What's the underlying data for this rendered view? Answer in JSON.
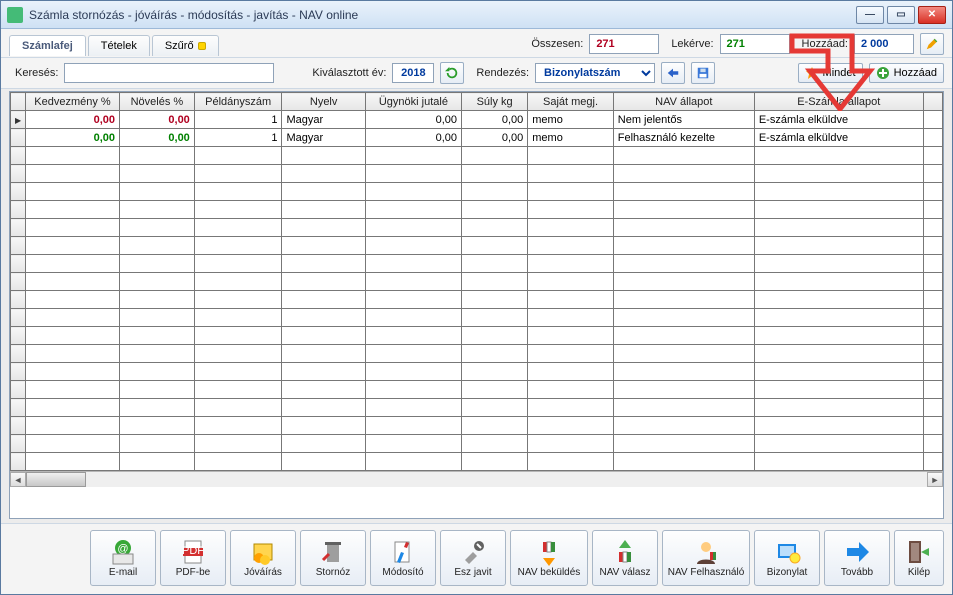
{
  "window": {
    "title": "Számla stornózás - jóváírás - módosítás - javítás - NAV online"
  },
  "tabs": {
    "t0": "Számlafej",
    "t1": "Tételek",
    "t2": "Szűrő"
  },
  "summary": {
    "osszesen_label": "Összesen:",
    "osszesen": "271",
    "lekerve_label": "Lekérve:",
    "lekerve": "271",
    "hozzaad_label": "Hozzáad:",
    "hozzaad": "2 000"
  },
  "toolbar": {
    "kereses_label": "Keresés:",
    "kivalasztott_ev_label": "Kiválasztott év:",
    "year": "2018",
    "rendezes_label": "Rendezés:",
    "rendezes_value": "Bizonylatszám",
    "mindet": "Mindet",
    "hozzaad": "Hozzáad"
  },
  "grid": {
    "headers": {
      "h0": "Kedvezmény %",
      "h1": "Növelés %",
      "h2": "Példányszám",
      "h3": "Nyelv",
      "h4": "Ügynöki jutalé",
      "h5": "Súly kg",
      "h6": "Saját megj.",
      "h7": "NAV állapot",
      "h8": "E-Számla állapot"
    },
    "rows": [
      {
        "kedv": "0,00",
        "nov": "0,00",
        "peld": "1",
        "nyelv": "Magyar",
        "jutalek": "0,00",
        "suly": "0,00",
        "megj": "memo",
        "nav": "Nem jelentős",
        "eszamla": "E-számla elküldve"
      },
      {
        "kedv": "0,00",
        "nov": "0,00",
        "peld": "1",
        "nyelv": "Magyar",
        "jutalek": "0,00",
        "suly": "0,00",
        "megj": "memo",
        "nav": "Felhasználó kezelte",
        "eszamla": "E-számla elküldve"
      }
    ]
  },
  "buttons": {
    "b0": "E-mail",
    "b1": "PDF-be",
    "b2": "Jóváírás",
    "b3": "Stornóz",
    "b4": "Módosító",
    "b5": "Esz javit",
    "b6": "NAV beküldés",
    "b7": "NAV válasz",
    "b8": "NAV Felhasználó",
    "b9": "Bizonylat",
    "b10": "Tovább",
    "b11": "Kilép"
  }
}
